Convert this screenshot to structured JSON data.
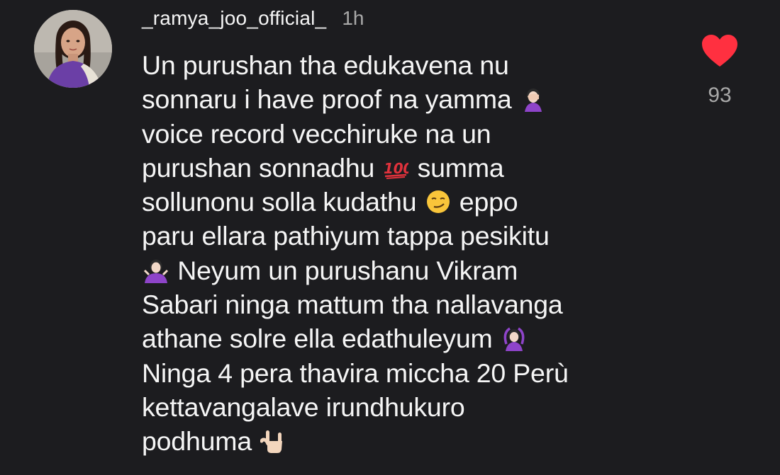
{
  "comment": {
    "username": "_ramya_joo_official_",
    "timestamp": "1h",
    "lines": [
      {
        "before": "Un purushan tha edukavena nu",
        "emoji": "",
        "after": ""
      },
      {
        "before": "sonnaru i have proof na yamma ",
        "emoji": "woman-facepalming-emoji",
        "after": ""
      },
      {
        "before": "voice record vecchiruke na un",
        "emoji": "",
        "after": ""
      },
      {
        "before": "purushan sonnadhu ",
        "emoji": "hundred-points-emoji",
        "after": " summa"
      },
      {
        "before": "sollunonu solla kudathu ",
        "emoji": "smirking-face-emoji",
        "after": " eppo"
      },
      {
        "before": "paru ellara pathiyum tappa pesikitu",
        "emoji": "",
        "after": ""
      },
      {
        "before": "",
        "emoji": "woman-shrugging-emoji",
        "after": " Neyum un purushanu Vikram"
      },
      {
        "before": "Sabari ninga mattum tha nallavanga",
        "emoji": "",
        "after": ""
      },
      {
        "before": "athane solre ella edathuleyum ",
        "emoji": "woman-ok-gesture-emoji",
        "after": ""
      },
      {
        "before": "Ninga 4 pera thavira miccha 20 Perù",
        "emoji": "",
        "after": ""
      },
      {
        "before": "kettavangalave irundhukuro",
        "emoji": "",
        "after": ""
      },
      {
        "before": "podhuma ",
        "emoji": "love-you-gesture-emoji",
        "after": ""
      }
    ],
    "like_count": "93",
    "colors": {
      "background": "#1c1c1f",
      "text": "#f5f5f5",
      "muted": "#a8a8a8",
      "heart": "#ff3040"
    }
  }
}
